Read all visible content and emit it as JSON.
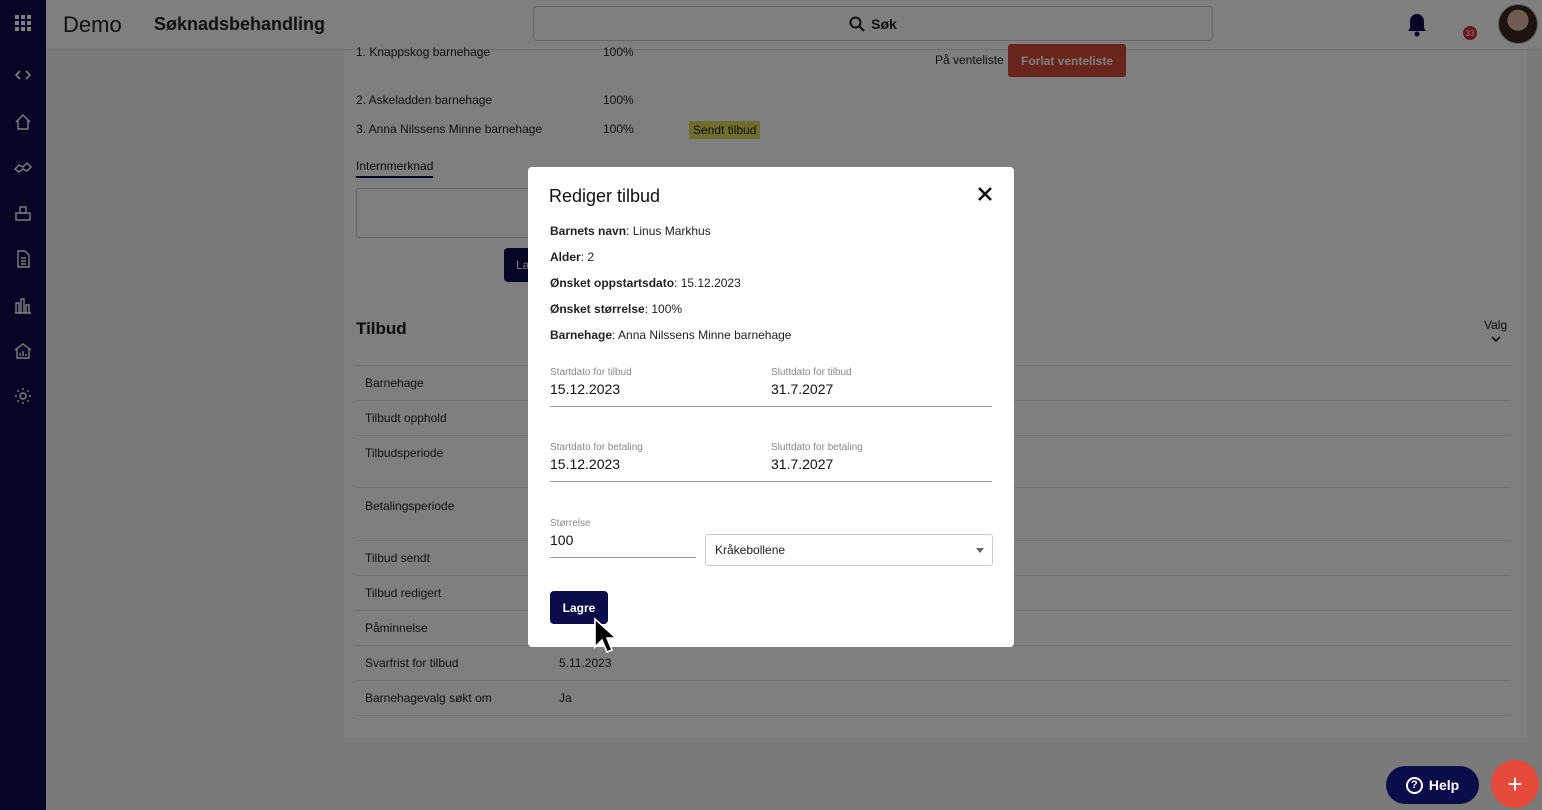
{
  "topbar": {
    "brand": "Demo",
    "title": "Søknadsbehandling",
    "search_label": "Søk",
    "notification_count": "33"
  },
  "background": {
    "choices": [
      {
        "name": "1. Knappskog barnehage",
        "size": "100%"
      },
      {
        "name": "2. Askeladden barnehage",
        "size": "100%"
      },
      {
        "name": "3. Anna Nilssens Minne barnehage",
        "size": "100%"
      }
    ],
    "sent_badge": "Sendt tilbud",
    "waitlist_label": "På venteliste",
    "leave_waitlist_button": "Forlat venteliste",
    "intern_tab": "Internmerknad",
    "intern_save_button": "La",
    "tilbud_title": "Tilbud",
    "valg_label": "Valg",
    "rows": [
      {
        "label": "Barnehage",
        "value": ""
      },
      {
        "label": "Tilbudt opphold",
        "value": ""
      },
      {
        "label": "Tilbudsperiode",
        "value": ""
      },
      {
        "label": "Betalingsperiode",
        "value": ""
      },
      {
        "label": "Tilbud sendt",
        "value": ""
      },
      {
        "label": "Tilbud redigert",
        "value": ""
      },
      {
        "label": "Påminnelse",
        "value": ""
      },
      {
        "label": "Svarfrist for tilbud",
        "value": "5.11.2023"
      },
      {
        "label": "Barnehagevalg søkt om",
        "value": "Ja"
      }
    ]
  },
  "modal": {
    "title": "Rediger tilbud",
    "info": [
      {
        "label": "Barnets navn",
        "value": ": Linus Markhus"
      },
      {
        "label": "Alder",
        "value": ": 2"
      },
      {
        "label": "Ønsket oppstartsdato",
        "value": ": 15.12.2023"
      },
      {
        "label": "Ønsket størrelse",
        "value": ": 100%"
      },
      {
        "label": "Barnehage",
        "value": ": Anna Nilssens Minne barnehage"
      }
    ],
    "fields": {
      "offer_start_label": "Startdato for tilbud",
      "offer_start": "15.12.2023",
      "offer_end_label": "Sluttdato for tilbud",
      "offer_end": "31.7.2027",
      "pay_start_label": "Startdato for betaling",
      "pay_start": "15.12.2023",
      "pay_end_label": "Sluttdato for betaling",
      "pay_end": "31.7.2027",
      "size_label": "Størrelse",
      "size": "100"
    },
    "department": "Kråkebollene",
    "save_button": "Lagre"
  },
  "help_button": "Help",
  "fab_symbol": "+"
}
